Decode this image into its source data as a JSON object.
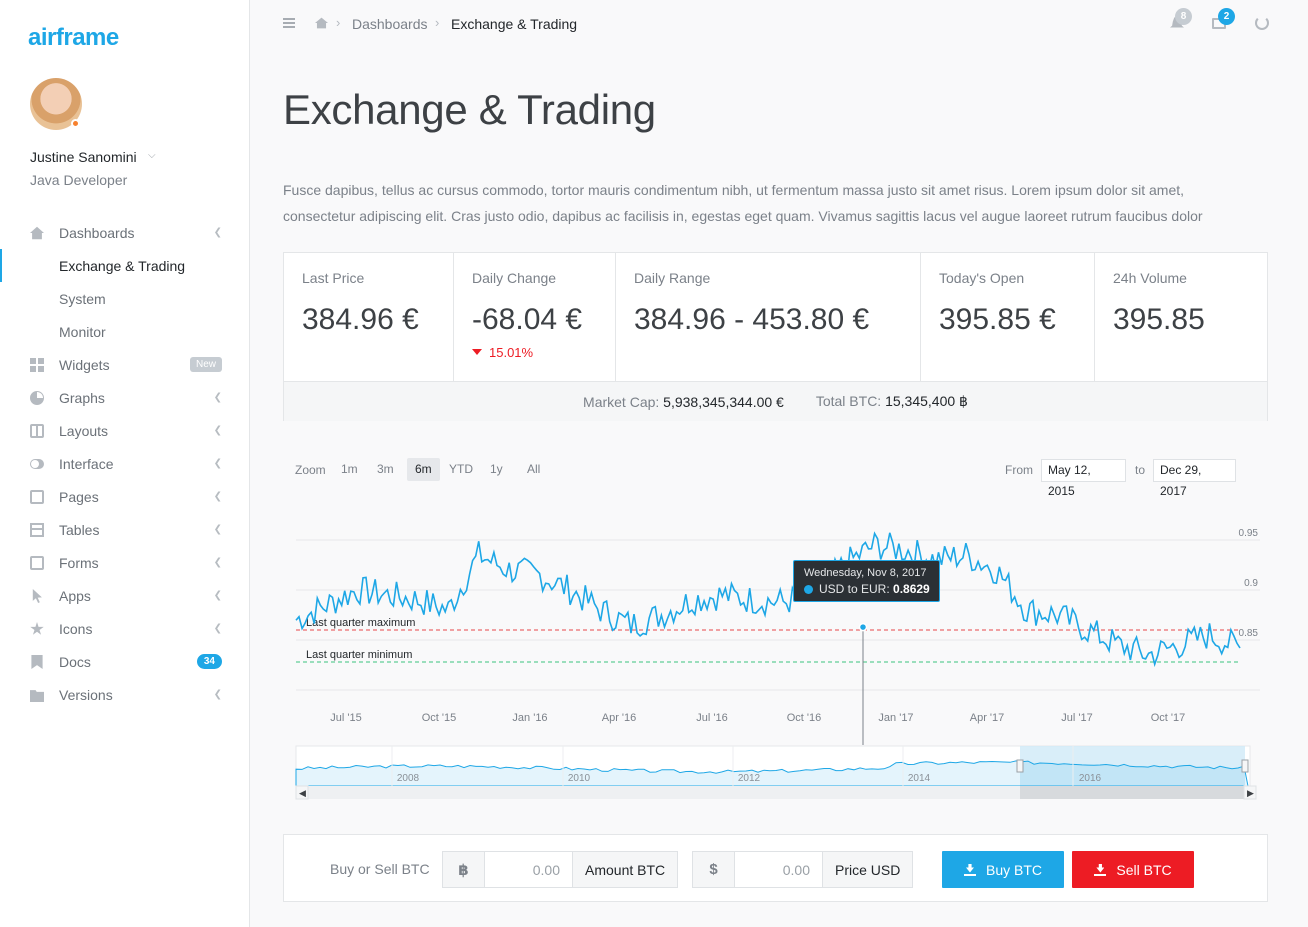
{
  "brand": "airframe",
  "user": {
    "name": "Justine Sanomini",
    "role": "Java Developer"
  },
  "sidebar": {
    "items": [
      {
        "label": "Dashboards",
        "icon": "home-icon"
      },
      {
        "label": "Exchange & Trading",
        "sub": true,
        "active": true
      },
      {
        "label": "System",
        "sub": true
      },
      {
        "label": "Monitor",
        "sub": true
      },
      {
        "label": "Widgets",
        "icon": "grid-icon",
        "badge": "New"
      },
      {
        "label": "Graphs",
        "icon": "pie-chart-icon"
      },
      {
        "label": "Layouts",
        "icon": "layout-icon"
      },
      {
        "label": "Interface",
        "icon": "toggle-icon"
      },
      {
        "label": "Pages",
        "icon": "pages-icon"
      },
      {
        "label": "Tables",
        "icon": "table-icon"
      },
      {
        "label": "Forms",
        "icon": "check-square-icon"
      },
      {
        "label": "Apps",
        "icon": "pointer-icon"
      },
      {
        "label": "Icons",
        "icon": "star-icon"
      },
      {
        "label": "Docs",
        "icon": "bookmark-icon",
        "count": "34"
      },
      {
        "label": "Versions",
        "icon": "folder-icon"
      }
    ]
  },
  "topbar": {
    "breadcrumb": [
      "Dashboards",
      "Exchange & Trading"
    ],
    "notifications_count": "8",
    "messages_count": "2"
  },
  "page": {
    "title": "Exchange & Trading",
    "lead": "Fusce dapibus, tellus ac cursus commodo, tortor mauris condimentum nibh, ut fermentum massa justo sit amet risus. Lorem ipsum dolor sit amet, consectetur adipiscing elit. Cras justo odio, dapibus ac facilisis in, egestas eget quam. Vivamus sagittis lacus vel augue laoreet rutrum faucibus dolor"
  },
  "stats": {
    "last_price": {
      "label": "Last Price",
      "value": "384.96 €"
    },
    "daily_change": {
      "label": "Daily Change",
      "value": "-68.04 €",
      "percent": "15.01%"
    },
    "daily_range": {
      "label": "Daily Range",
      "value": "384.96 - 453.80 €"
    },
    "todays_open": {
      "label": "Today's Open",
      "value": "395.85 €"
    },
    "volume": {
      "label": "24h Volume",
      "value": "395.85"
    },
    "market_cap_label": "Market Cap:",
    "market_cap": "5,938,345,344.00 €",
    "total_btc_label": "Total BTC:",
    "total_btc": "15,345,400 ฿"
  },
  "chart_controls": {
    "zoom_label": "Zoom",
    "buttons": [
      "1m",
      "3m",
      "6m",
      "YTD",
      "1y",
      "All"
    ],
    "active": "6m",
    "from_label": "From",
    "from": "May 12, 2015",
    "to_label": "to",
    "to": "Dec 29, 2017"
  },
  "tooltip": {
    "date": "Wednesday, Nov 8, 2017",
    "series": "USD to EUR:",
    "value": "0.8629"
  },
  "chart_data": {
    "type": "line",
    "series": [
      {
        "name": "USD to EUR"
      }
    ],
    "x_ticks": [
      "Jul '15",
      "Oct '15",
      "Jan '16",
      "Apr '16",
      "Jul '16",
      "Oct '16",
      "Jan '17",
      "Apr '17",
      "Jul '17",
      "Oct '17"
    ],
    "y_ticks": [
      "0.95",
      "0.9",
      "0.85"
    ],
    "ylim": [
      0.8,
      0.96
    ],
    "plot_lines": [
      {
        "label": "Last quarter maximum",
        "value": 0.86,
        "color": "#e8474a"
      },
      {
        "label": "Last quarter minimum",
        "value": 0.828,
        "color": "#3ac47d"
      }
    ],
    "x": [
      "2015-05",
      "2015-06",
      "2015-07",
      "2015-08",
      "2015-09",
      "2015-10",
      "2015-11",
      "2015-12",
      "2016-01",
      "2016-02",
      "2016-03",
      "2016-04",
      "2016-05",
      "2016-06",
      "2016-07",
      "2016-08",
      "2016-09",
      "2016-10",
      "2016-11",
      "2016-12",
      "2017-01",
      "2017-02",
      "2017-03",
      "2017-04",
      "2017-05",
      "2017-06",
      "2017-07",
      "2017-08",
      "2017-09",
      "2017-10",
      "2017-11",
      "2017-12"
    ],
    "values": [
      0.87,
      0.885,
      0.9,
      0.895,
      0.89,
      0.88,
      0.935,
      0.92,
      0.915,
      0.9,
      0.88,
      0.865,
      0.875,
      0.89,
      0.895,
      0.89,
      0.888,
      0.895,
      0.925,
      0.945,
      0.94,
      0.93,
      0.935,
      0.92,
      0.88,
      0.875,
      0.86,
      0.845,
      0.835,
      0.845,
      0.855,
      0.842
    ],
    "navigator_x_ticks": [
      "2008",
      "2010",
      "2012",
      "2014",
      "2016"
    ]
  },
  "trade": {
    "label": "Buy or Sell BTC",
    "btc_symbol": "฿",
    "btc_amount": "0.00",
    "btc_unit": "Amount BTC",
    "usd_symbol": "$",
    "usd_amount": "0.00",
    "usd_unit": "Price USD",
    "buy_label": "Buy BTC",
    "sell_label": "Sell BTC"
  },
  "colors": {
    "accent": "#1ea7e6",
    "danger": "#ed1c24",
    "status": "#f7812e"
  }
}
